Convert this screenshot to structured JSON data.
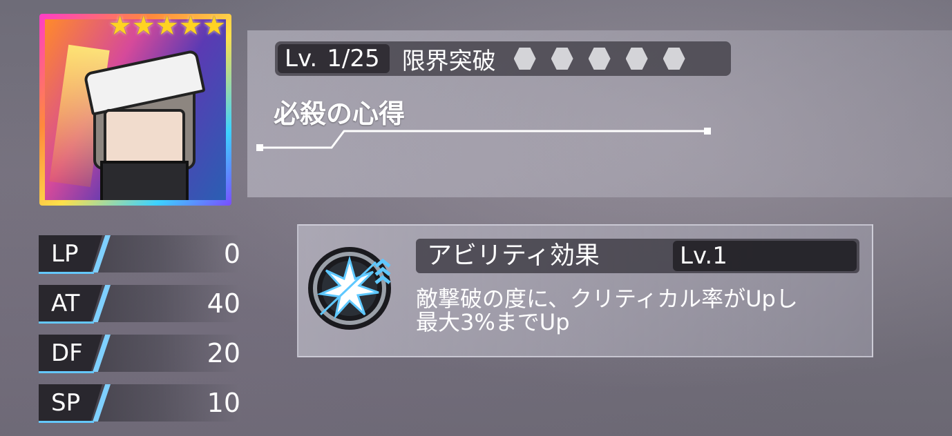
{
  "character": {
    "stars": "★★★★★",
    "rarity_stars": 5
  },
  "header": {
    "level_label": "Lv.",
    "level_value": "1/25",
    "limit_break_label": "限界突破",
    "limit_break_slots": 5
  },
  "skill": {
    "name": "必殺の心得"
  },
  "stats": [
    {
      "label": "LP",
      "value": "0"
    },
    {
      "label": "AT",
      "value": "40"
    },
    {
      "label": "DF",
      "value": "20"
    },
    {
      "label": "SP",
      "value": "10"
    }
  ],
  "ability": {
    "title": "アビリティ効果",
    "level": "Lv.1",
    "description_line1": "敵撃破の度に、クリティカル率がUpし",
    "description_line2": "最大3%までUp",
    "icon": "critical-burst-icon"
  },
  "colors": {
    "accent": "#64c8ff",
    "star": "#ffd323",
    "hex_slot": "#d4d4d8"
  }
}
